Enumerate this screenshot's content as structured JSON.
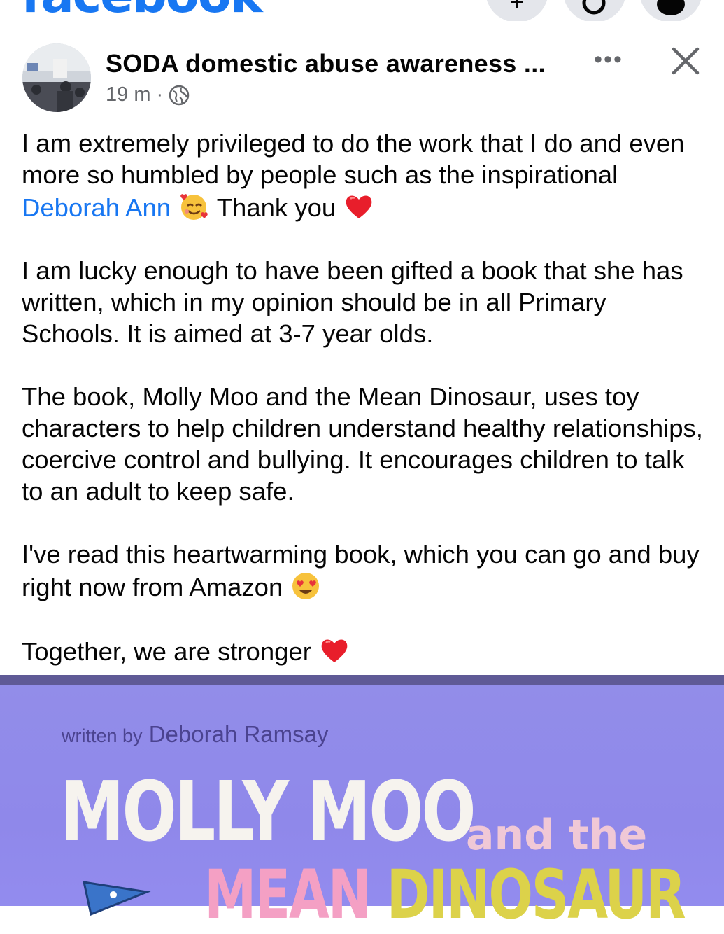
{
  "app": {
    "logo": "facebook"
  },
  "post": {
    "author": "SODA domestic abuse awareness ...",
    "time": "19 m",
    "separator": "·",
    "more_label": "•••",
    "paragraphs": {
      "p1_a": "I am extremely privileged to do the work that I do and even more so humbled by people such as the inspirational ",
      "p1_mention": "Deborah Ann",
      "p1_b": " Thank you ",
      "p2": "I am lucky enough to have been gifted a book that she has written, which in my opinion should be in all Primary Schools. It is aimed at 3-7 year olds.",
      "p3": "The book, Molly Moo and the Mean Dinosaur, uses toy characters to help children understand healthy relationships, coercive control and bullying. It encourages children to talk to an adult to keep safe.",
      "p4": "I've read this heartwarming book, which you can go and buy right now from Amazon ",
      "p5": "Together, we are stronger "
    }
  },
  "photo": {
    "byline_small": "written by",
    "byline_name": "Deborah Ramsay",
    "title_line1": "MOLLY MOO",
    "title_and": "and the",
    "title_mean": "MEAN",
    "title_dino": "DINOSAUR"
  },
  "colors": {
    "brand": "#1877f2",
    "mention": "#1877f2",
    "meta": "#65676b",
    "cover": "#8f88ea"
  },
  "icons": [
    "search-icon",
    "messenger-icon",
    "globe-icon",
    "more-icon",
    "close-icon",
    "smiling-face-with-hearts-icon",
    "heart-icon",
    "heart-eyes-icon"
  ]
}
